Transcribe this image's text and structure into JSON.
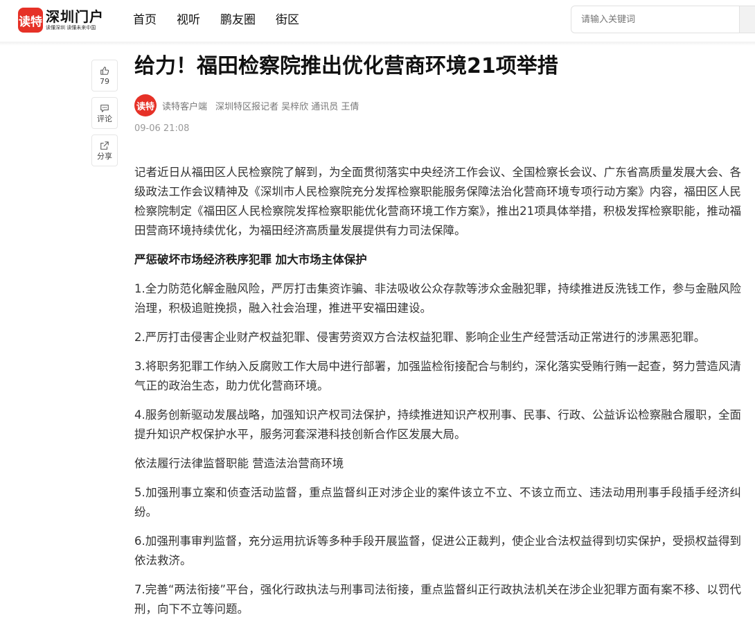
{
  "header": {
    "logo_mark": "读特",
    "logo_name": "深圳门户",
    "logo_slogan": "读懂深圳 读懂未来中国",
    "nav": [
      "首页",
      "视听",
      "鹏友圈",
      "街区"
    ],
    "search_placeholder": "请输入关键词"
  },
  "side": {
    "likes": "79",
    "comment": "评论",
    "share": "分享"
  },
  "article": {
    "title": "给力！福田检察院推出优化营商环境21项举措",
    "avatar_text": "读特",
    "source": "读特客户端",
    "byline": "深圳特区报记者 吴梓欣 通讯员 王倩",
    "time": "09-06 21:08",
    "paragraphs": [
      {
        "text": "记者近日从福田区人民检察院了解到，为全面贯彻落实中央经济工作会议、全国检察长会议、广东省高质量发展大会、各级政法工作会议精神及《深圳市人民检察院充分发挥检察职能服务保障法治化营商环境专项行动方案》内容，福田区人民检察院制定《福田区人民检察院发挥检察职能优化营商环境工作方案》，推出21项具体举措，积极发挥检察职能，推动福田营商环境持续优化，为福田经济高质量发展提供有力司法保障。",
        "bold": false
      },
      {
        "text": "严惩破坏市场经济秩序犯罪 加大市场主体保护",
        "bold": true
      },
      {
        "text": "1.全力防范化解金融风险，严厉打击集资诈骗、非法吸收公众存款等涉众金融犯罪，持续推进反洗钱工作，参与金融风险治理，积极追赃挽损，融入社会治理，推进平安福田建设。",
        "bold": false
      },
      {
        "text": "2.严厉打击侵害企业财产权益犯罪、侵害劳资双方合法权益犯罪、影响企业生产经营活动正常进行的涉黑恶犯罪。",
        "bold": false
      },
      {
        "text": "3.将职务犯罪工作纳入反腐败工作大局中进行部署，加强监检衔接配合与制约，深化落实受贿行贿一起查，努力营造风清气正的政治生态，助力优化营商环境。",
        "bold": false
      },
      {
        "text": "4.服务创新驱动发展战略，加强知识产权司法保护，持续推进知识产权刑事、民事、行政、公益诉讼检察融合履职，全面提升知识产权保护水平，服务河套深港科技创新合作区发展大局。",
        "bold": false
      },
      {
        "text": "依法履行法律监督职能 营造法治营商环境",
        "bold": false
      },
      {
        "text": "5.加强刑事立案和侦查活动监督，重点监督纠正对涉企业的案件该立不立、不该立而立、违法动用刑事手段插手经济纠纷。",
        "bold": false
      },
      {
        "text": "6.加强刑事审判监督，充分运用抗诉等多种手段开展监督，促进公正裁判，使企业合法权益得到切实保护，受损权益得到依法救济。",
        "bold": false
      },
      {
        "text": "7.完善“两法衔接”平台，强化行政执法与刑事司法衔接，重点监督纠正行政执法机关在涉企业犯罪方面有案不移、以罚代刑，向下不立等问题。",
        "bold": false
      }
    ]
  }
}
